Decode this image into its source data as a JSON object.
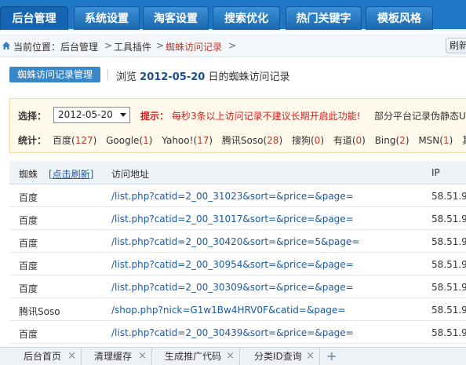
{
  "topnav": {
    "tabs": [
      {
        "label": "后台管理",
        "active": true
      },
      {
        "label": "系统设置",
        "active": false
      },
      {
        "label": "淘客设置",
        "active": false
      },
      {
        "label": "搜索优化",
        "active": false
      },
      {
        "label": "热门关键字",
        "active": false
      },
      {
        "label": "模板风格",
        "active": false
      }
    ]
  },
  "breadcrumb": {
    "prefix": "当前位置：",
    "items": [
      "后台管理",
      "工具插件",
      "蜘蛛访问记录"
    ],
    "separator": ">",
    "refresh_label": "刷新"
  },
  "header": {
    "manage_button": "蜘蛛访问记录管理",
    "browse_prefix": "浏览",
    "date": "2012-05-20",
    "browse_suffix": "日的蜘蛛访问记录"
  },
  "filter": {
    "select_label": "选择：",
    "date_value": "2012-05-20",
    "tip_label": "提示：",
    "tip_text": "每秒3条以上访问记录不建议长期开启此功能!",
    "note": "部分平台记录伪静态U",
    "stats_label": "统计：",
    "stats": [
      {
        "name": "百度",
        "count": "127"
      },
      {
        "name": "Google",
        "count": "1"
      },
      {
        "name": "Yahoo!",
        "count": "17"
      },
      {
        "name": "腾讯Soso",
        "count": "28"
      },
      {
        "name": "搜狗",
        "count": "0"
      },
      {
        "name": "有道",
        "count": "0"
      },
      {
        "name": "Bing",
        "count": "2"
      },
      {
        "name": "MSN",
        "count": "1"
      },
      {
        "name": "其他",
        "count": ""
      }
    ]
  },
  "table": {
    "col_spider": "蜘蛛",
    "refresh_link": "[点击刷新]",
    "col_url": "访问地址",
    "col_ip": "IP",
    "rows": [
      {
        "spider": "百度",
        "url": "/list.php?catid=2_00_31023&sort=&price=&page=",
        "ip": "58.51.9"
      },
      {
        "spider": "百度",
        "url": "/list.php?catid=2_00_31017&sort=&price=&page=",
        "ip": "58.51.9"
      },
      {
        "spider": "百度",
        "url": "/list.php?catid=2_00_30420&sort=&price=5&page=",
        "ip": "58.51.9"
      },
      {
        "spider": "百度",
        "url": "/list.php?catid=2_00_30954&sort=&price=&page=",
        "ip": "58.51.9"
      },
      {
        "spider": "百度",
        "url": "/list.php?catid=2_00_30309&sort=&price=&page=",
        "ip": "58.51.9"
      },
      {
        "spider": "腾讯Soso",
        "url": "/shop.php?nick=G1w1Bw4HRV0F&catid=&page=",
        "ip": "58.51.9"
      },
      {
        "spider": "百度",
        "url": "/list.php?catid=2_00_30439&sort=&price=&page=",
        "ip": "58.51.9"
      }
    ]
  },
  "bottombar": {
    "tabs": [
      "后台首页",
      "清理缓存",
      "生成推广代码",
      "分类ID查询"
    ],
    "close_glyph": "×",
    "add_glyph": "+"
  }
}
